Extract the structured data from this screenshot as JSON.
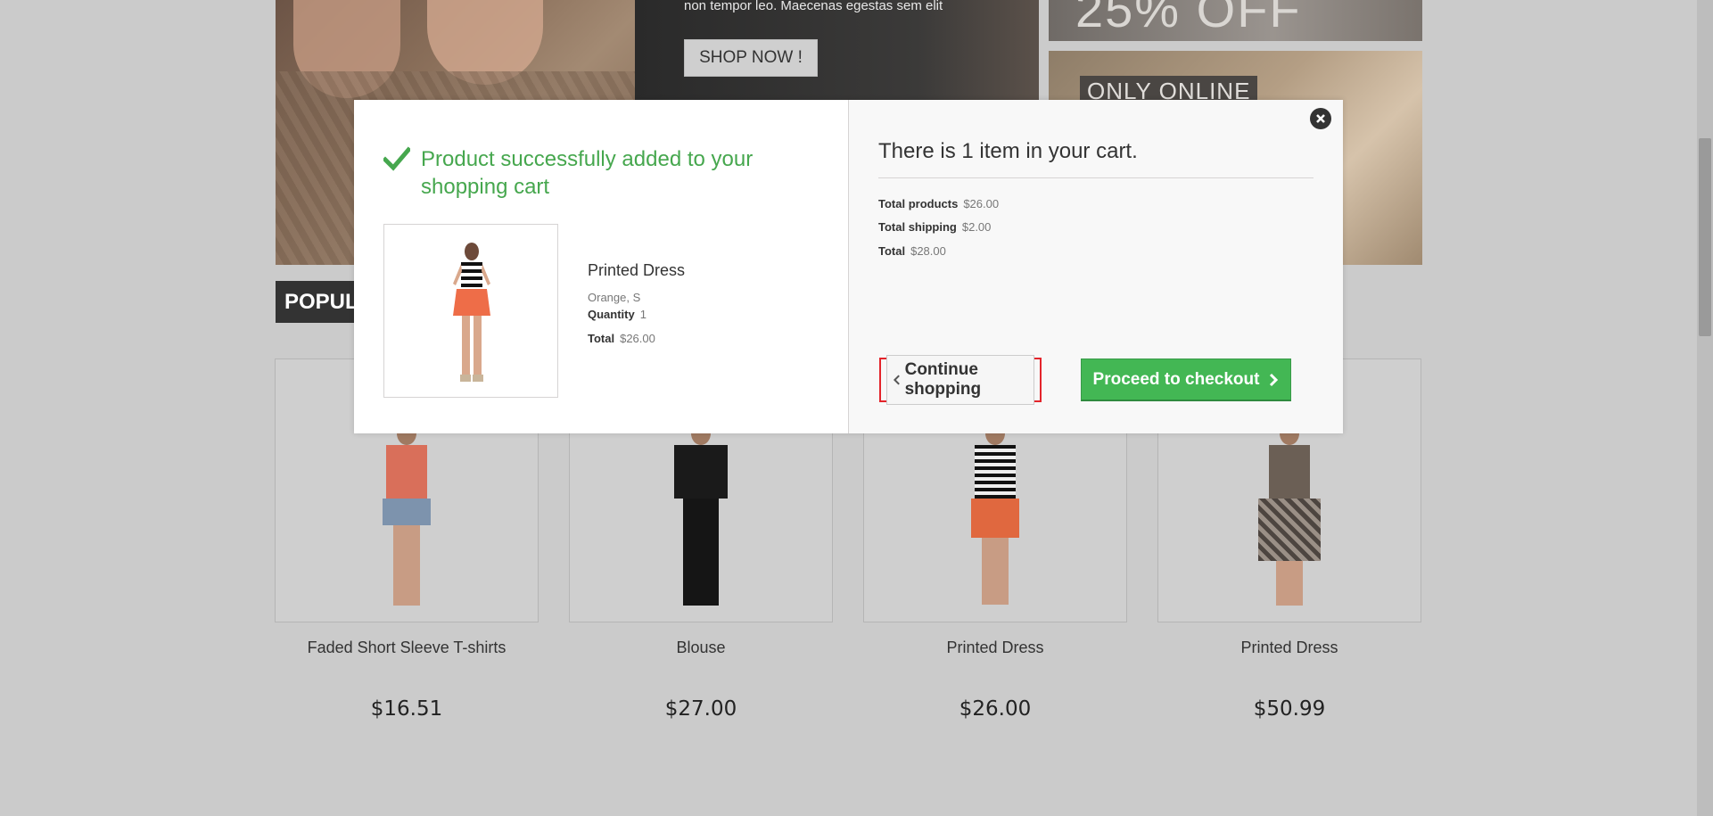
{
  "hero": {
    "text": "non tempor leo. Maecenas egestas sem elit",
    "shop_now": "SHOP NOW !",
    "banner_big": "25% OFF",
    "only_online": "ONLY ONLINE"
  },
  "section_tab": "POPULAR",
  "products": [
    {
      "name": "Faded Short Sleeve T-shirts",
      "price": "$16.51"
    },
    {
      "name": "Blouse",
      "price": "$27.00"
    },
    {
      "name": "Printed Dress",
      "price": "$26.00"
    },
    {
      "name": "Printed Dress",
      "price": "$50.99"
    }
  ],
  "modal": {
    "success_title": "Product successfully added to your shopping cart",
    "product_name": "Printed Dress",
    "attributes": "Orange, S",
    "quantity_label": "Quantity",
    "quantity_value": "1",
    "total_label": "Total",
    "total_value": "$26.00",
    "cart_title": "There is 1 item in your cart.",
    "summary": {
      "total_products_label": "Total products",
      "total_products_value": "$26.00",
      "total_shipping_label": "Total shipping",
      "total_shipping_value": "$2.00",
      "total_label": "Total",
      "total_value": "$28.00"
    },
    "continue_label": "Continue shopping",
    "checkout_label": "Proceed to checkout"
  },
  "colors": {
    "success_green": "#46a74e",
    "checkout_green": "#43b754",
    "highlight_red": "#e3242b",
    "overlay": "#cbcbcb"
  },
  "icons": {
    "success": "check-icon",
    "close": "close-icon",
    "continue": "chevron-left-icon",
    "checkout": "chevron-right-icon"
  }
}
